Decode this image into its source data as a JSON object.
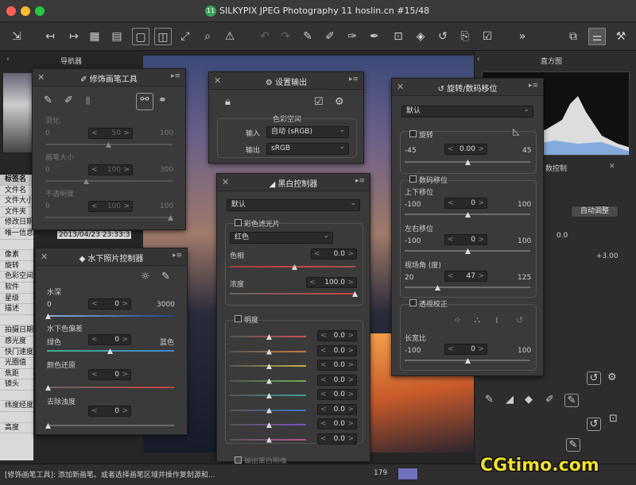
{
  "window": {
    "title": "SILKYPIX JPEG Photography 11 hoslin.cn   #15/48",
    "badge": "11"
  },
  "navigator": {
    "title": "导航器"
  },
  "histogram": {
    "title": "直方图"
  },
  "left_table": {
    "header": "标签名",
    "rows": [
      "文件名",
      "文件大小",
      "文件夹",
      "修改日期",
      "唯一信息",
      "",
      "像素",
      "旋转",
      "色彩空间",
      "软件",
      "星级",
      "描述",
      "",
      "拍摄日期",
      "感光度",
      "快门速度",
      "光圈值",
      "焦距",
      "镜头",
      "",
      "纬度经度",
      "",
      "高度"
    ],
    "date_value": "2013/04/23 23:33:3"
  },
  "brush_panel": {
    "title": "修饰画笔工具",
    "feather_label": "羽化",
    "feather_min": "0",
    "feather_value": "50",
    "feather_max": "100",
    "size_label": "画笔大小",
    "size_min": "0",
    "size_value": "100",
    "size_max": "300",
    "opacity_label": "不透明度",
    "opacity_min": "0",
    "opacity_value": "100",
    "opacity_max": "100"
  },
  "output_panel": {
    "title": "设置输出",
    "colorspace_label": "色彩空间",
    "input_label": "输入",
    "input_value": "自动 (sRGB)",
    "output_label": "输出",
    "output_value": "sRGB"
  },
  "bw_panel": {
    "title": "黑白控制器",
    "preset": "默认",
    "filter_label": "彩色滤光片",
    "filter_color": "红色",
    "hue_label": "色相",
    "hue_value": "0.0",
    "strength_label": "浓度",
    "strength_value": "100.0",
    "brightness_label": "明度",
    "brightness_values": [
      "0.0",
      "0.0",
      "0.0",
      "0.0",
      "0.0",
      "0.0",
      "0.0",
      "0.0"
    ],
    "brightness_colors": [
      "#d05050",
      "#d07a40",
      "#c8b040",
      "#70b050",
      "#40a0a0",
      "#4070c8",
      "#8050c8",
      "#c050a0"
    ],
    "output_bw_label": "输出黑白图像"
  },
  "rotate_panel": {
    "title": "旋转/数码移位",
    "preset": "默认",
    "rotate_label": "旋转",
    "rotate_min": "-45",
    "rotate_value": "0.00",
    "rotate_max": "45",
    "shift_label": "数码移位",
    "vshift_label": "上下移位",
    "vshift_min": "-100",
    "vshift_value": "0",
    "vshift_max": "100",
    "hshift_label": "左右移位",
    "hshift_min": "-100",
    "hshift_value": "0",
    "hshift_max": "100",
    "fov_label": "视场角 (度)",
    "fov_min": "20",
    "fov_value": "47",
    "fov_max": "125",
    "persp_label": "透视校正",
    "aspect_label": "长宽比",
    "aspect_min": "-100",
    "aspect_value": "0",
    "aspect_max": "100"
  },
  "underwater_panel": {
    "title": "水下照片控制器",
    "depth_label": "水深",
    "depth_min": "0",
    "depth_value": "0",
    "depth_max": "3000",
    "bias_label": "水下色偏差",
    "bias_left": "绿色",
    "bias_value": "0",
    "bias_right": "蓝色",
    "restore_label": "颜色还原",
    "restore_value": "0",
    "dehaze_label": "去除浊度",
    "dehaze_value": "0"
  },
  "right_controls": {
    "exposure_label": "数控制",
    "auto_adjust": "自动调整",
    "exp_value": "0.0",
    "exp_max": "+3.00"
  },
  "status": {
    "text": "[修饰画笔工具]: 添加新画笔。或者选择画笔区域并操作复制源和...",
    "number": "179",
    "swatch": "#7070c0"
  },
  "watermark": "CGtimo.com"
}
